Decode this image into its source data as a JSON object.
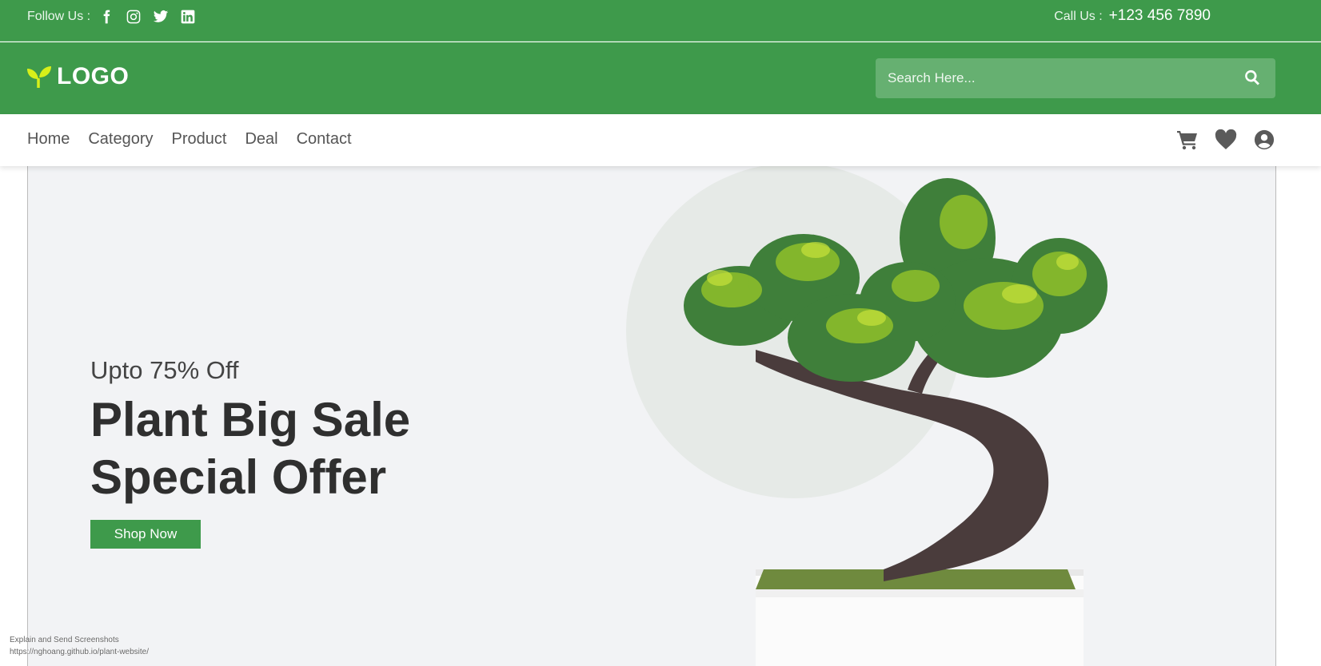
{
  "topbar": {
    "follow_label": "Follow Us :",
    "social_icons": [
      "facebook-icon",
      "instagram-icon",
      "twitter-icon",
      "linkedin-icon"
    ],
    "call_label": "Call Us :",
    "phone": "+123 456 7890"
  },
  "header": {
    "logo_text": "LOGO",
    "search_placeholder": "Search Here..."
  },
  "nav": {
    "links": [
      "Home",
      "Category",
      "Product",
      "Deal",
      "Contact"
    ],
    "icons": [
      "cart-icon",
      "heart-icon",
      "user-icon"
    ]
  },
  "hero": {
    "subtitle": "Upto 75% Off",
    "title_line1": "Plant Big Sale",
    "title_line2": "Special Offer",
    "button": "Shop Now"
  },
  "overlay": {
    "line1": "Explain and Send Screenshots",
    "line2": "https://nghoang.github.io/plant-website/"
  },
  "colors": {
    "brand_green": "#3e9a4b",
    "logo_leaf": "#d7ef1a",
    "hero_bg": "#f2f3f5"
  }
}
